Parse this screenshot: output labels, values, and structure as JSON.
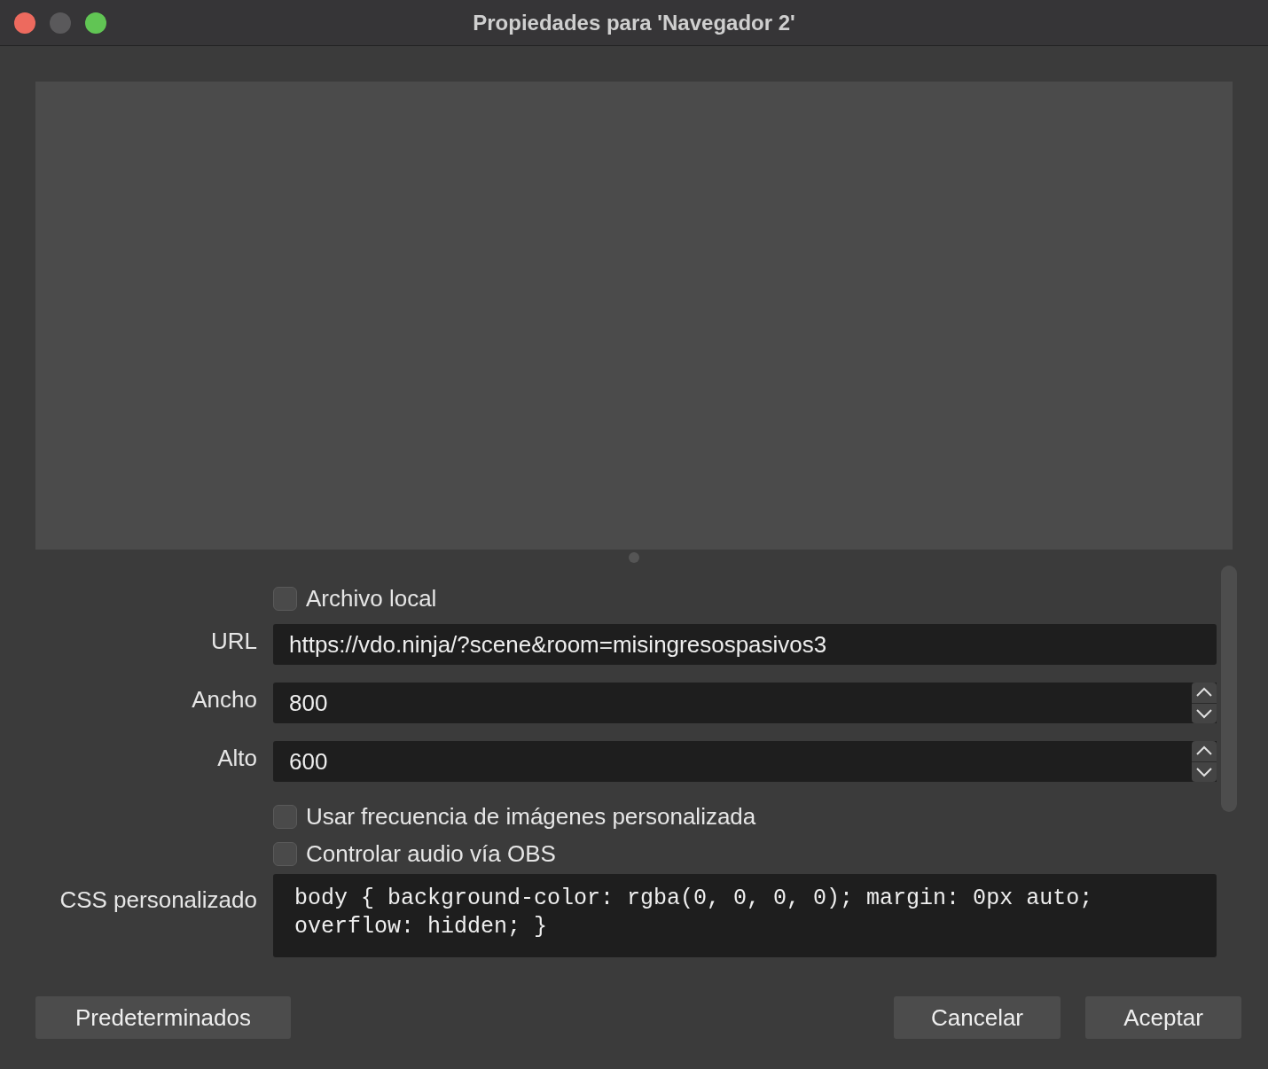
{
  "window": {
    "title": "Propiedades para 'Navegador 2'"
  },
  "fields": [
    {
      "kind": "checkbox",
      "label": "Archivo local",
      "checked": false
    },
    {
      "kind": "text",
      "label": "URL",
      "value": "https://vdo.ninja/?scene&room=misingresospasivos3"
    },
    {
      "kind": "number",
      "label": "Ancho",
      "value": "800"
    },
    {
      "kind": "number",
      "label": "Alto",
      "value": "600"
    },
    {
      "kind": "checkbox",
      "label": "Usar frecuencia de imágenes personalizada",
      "checked": false
    },
    {
      "kind": "checkbox",
      "label": "Controlar audio vía OBS",
      "checked": false
    },
    {
      "kind": "textarea",
      "label": "CSS personalizado",
      "value": "body { background-color: rgba(0, 0, 0, 0); margin: 0px auto; overflow: hidden; }"
    }
  ],
  "buttons_left": [
    "Predeterminados"
  ],
  "buttons_right": [
    "Cancelar",
    "Aceptar"
  ]
}
